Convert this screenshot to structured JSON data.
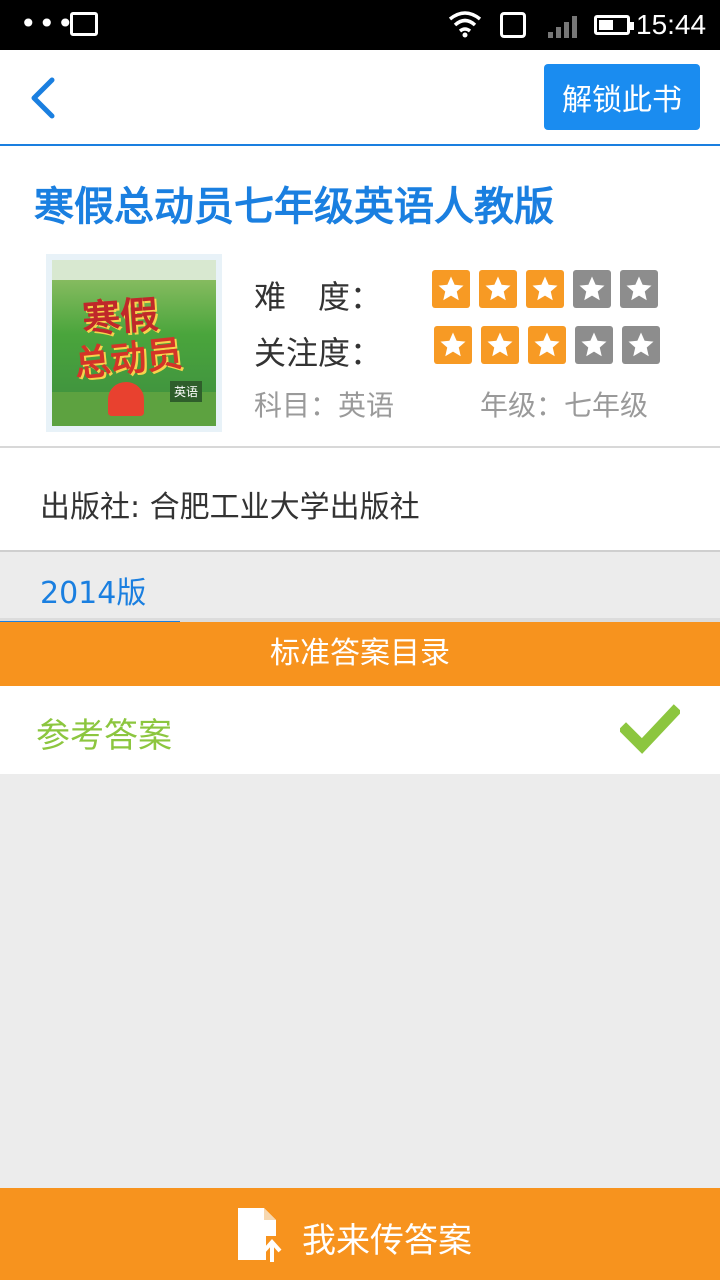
{
  "status_bar": {
    "time": "15:44",
    "icons": [
      "more-dots-icon",
      "image-icon",
      "wifi-icon",
      "sim-icon",
      "signal-icon",
      "battery-icon"
    ]
  },
  "toolbar": {
    "back_icon": "chevron-left-icon",
    "unlock_label": "解锁此书"
  },
  "book": {
    "title": "寒假总动员七年级英语人教版",
    "cover_title_line1": "寒假",
    "cover_title_line2": "总动员",
    "cover_tag": "英语",
    "difficulty_label": "难　度：",
    "difficulty_rating": 3,
    "attention_label": "关注度：",
    "attention_rating": 3,
    "max_rating": 5,
    "subject": "科目：英语",
    "grade": "年级：七年级"
  },
  "publisher": {
    "text": "出版社:  合肥工业大学出版社"
  },
  "tabs": {
    "active": "2014版"
  },
  "section": {
    "header": "标准答案目录",
    "items": [
      {
        "label": "参考答案",
        "status_icon": "check-icon"
      }
    ]
  },
  "bottom_action": {
    "label": "我来传答案",
    "icon": "file-upload-icon"
  },
  "colors": {
    "accent_blue": "#1a7fe0",
    "orange": "#f7931e",
    "green": "#8cc63f",
    "star_off": "#8d8d8d"
  }
}
